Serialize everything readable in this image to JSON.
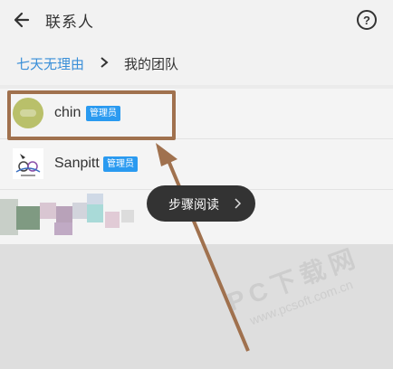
{
  "header": {
    "title": "联系人",
    "help_label": "?"
  },
  "breadcrumb": {
    "parent": "七天无理由",
    "current": "我的团队"
  },
  "members": [
    {
      "name": "chin",
      "badge": "管理员"
    },
    {
      "name": "Sanpitt",
      "badge": "管理员"
    }
  ],
  "tooltip": {
    "label": "步骤阅读"
  },
  "watermark": {
    "main": "PC下载网",
    "sub": "www.pcsoft.com.cn"
  },
  "colors": {
    "link": "#3a8fd8",
    "badge": "#2a9af0",
    "highlight": "#a0714e",
    "tooltip_bg": "#333333"
  }
}
